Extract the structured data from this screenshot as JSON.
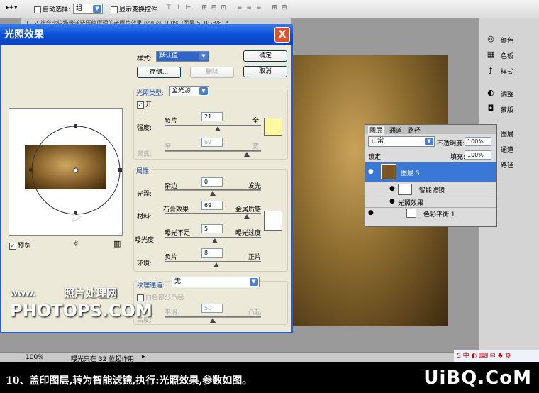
{
  "optbar": {
    "auto_select": "自动选择:",
    "auto_select_value": "组",
    "show_transform": "显示变换控件"
  },
  "doc_tab": "1.12 社会比较场景话费压缩原理的老照片效果.psd @ 100% (图层 5, RGB/8) *",
  "dialog": {
    "title": "光照效果",
    "close": "X",
    "style_label": "样式:",
    "style_value": "默认值",
    "ok": "确定",
    "cancel": "取消",
    "save": "存储...",
    "delete": "删除",
    "light_type_label": "光照类型:",
    "light_type_value": "全光源",
    "on_label": "开",
    "intensity": {
      "label": "强度:",
      "left": "负片",
      "right": "全",
      "value": "21",
      "fraction": 0.55
    },
    "focus": {
      "label": "聚焦:",
      "left": "窄",
      "right": "宽",
      "value": "69",
      "fraction": 0.85
    },
    "properties_label": "属性:",
    "gloss": {
      "label": "光泽:",
      "left": "杂边",
      "right": "发光",
      "value": "0",
      "fraction": 0.5
    },
    "material": {
      "label": "材料:",
      "left": "石膏效果",
      "right": "金属质感",
      "value": "69",
      "fraction": 0.85
    },
    "exposure": {
      "label": "曝光度:",
      "left": "曝光不足",
      "right": "曝光过度",
      "value": "5",
      "fraction": 0.52
    },
    "ambience": {
      "label": "环境:",
      "left": "负片",
      "right": "正片",
      "value": "8",
      "fraction": 0.54
    },
    "texture_label": "纹理通道:",
    "texture_value": "无",
    "white_high": "白色部分凸起",
    "height": {
      "label": "高度:",
      "left": "平滑",
      "right": "凸起",
      "value": "50",
      "fraction": 0.5
    },
    "preview_label": "预览"
  },
  "layers_panel": {
    "tabs": [
      "图层",
      "通道",
      "路径"
    ],
    "blend": "正常",
    "opacity_label": "不透明度:",
    "opacity": "100%",
    "lock_label": "锁定:",
    "fill_label": "填充:",
    "fill": "100%",
    "rows": [
      "图层 5",
      "智能滤镜",
      "光照效果",
      "色彩平衡 1"
    ]
  },
  "right_panel": [
    "颜色",
    "色板",
    "样式",
    "调整",
    "蒙版",
    "图层",
    "通道",
    "路径"
  ],
  "status": {
    "zoom": "100%",
    "info": "曝光只在 32 位起作用"
  },
  "watermark": {
    "line1": "照片处理网",
    "line2": "PHOTOPS.COM",
    "www": "WWW."
  },
  "caption": "10、盖印图层,转为智能滤镜,执行:光照效果,参数如图。",
  "logo": "UiBQ.CoM",
  "colors": {
    "title_blue": "#0b4fd8",
    "light_color": "#fff8a0",
    "accent": "#1848a8"
  }
}
